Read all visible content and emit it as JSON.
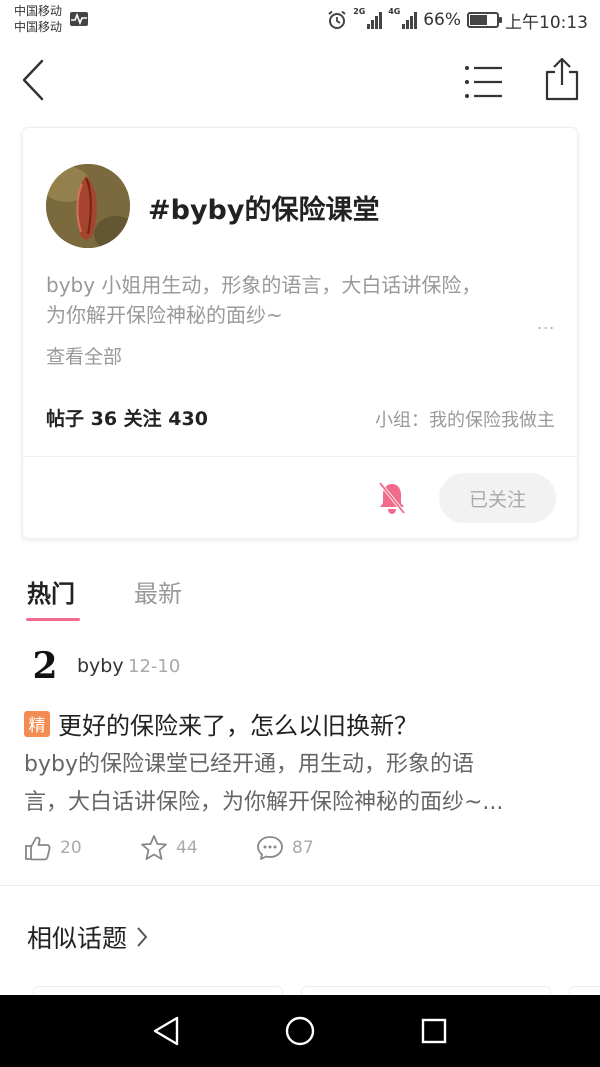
{
  "status_bar": {
    "carrier_1": "中国移动",
    "carrier_2": "中国移动",
    "net_2g": "2G",
    "net_4g": "4G",
    "battery": "66%",
    "battery_level": 0.66,
    "time": "上午10:13"
  },
  "topic": {
    "title": "#byby的保险课堂",
    "description_line1": "byby 小姐用生动，形象的语言，大白话讲保险，",
    "description_line2": "为你解开保险神秘的面纱~",
    "more": "...",
    "view_all": "查看全部",
    "stats": "帖子 36  关注 430",
    "group": "小组：我的保险我做主",
    "follow_button": "已关注"
  },
  "tabs": [
    {
      "label": "热门"
    },
    {
      "label": "最新"
    }
  ],
  "post": {
    "avatar_glyph": "2",
    "author": "byby",
    "date": "12-10",
    "badge": "精",
    "title": "更好的保险来了，怎么以旧换新？",
    "body_line1": "byby的保险课堂已经开通，用生动，形象的语",
    "body_line2": "言，大白话讲保险，为你解开保险神秘的面纱~...",
    "likes": "20",
    "favorites": "44",
    "comments": "87"
  },
  "similar_topics": {
    "heading": "相似话题"
  },
  "colors": {
    "accent": "#f06b8c",
    "badge": "#f28c52"
  }
}
